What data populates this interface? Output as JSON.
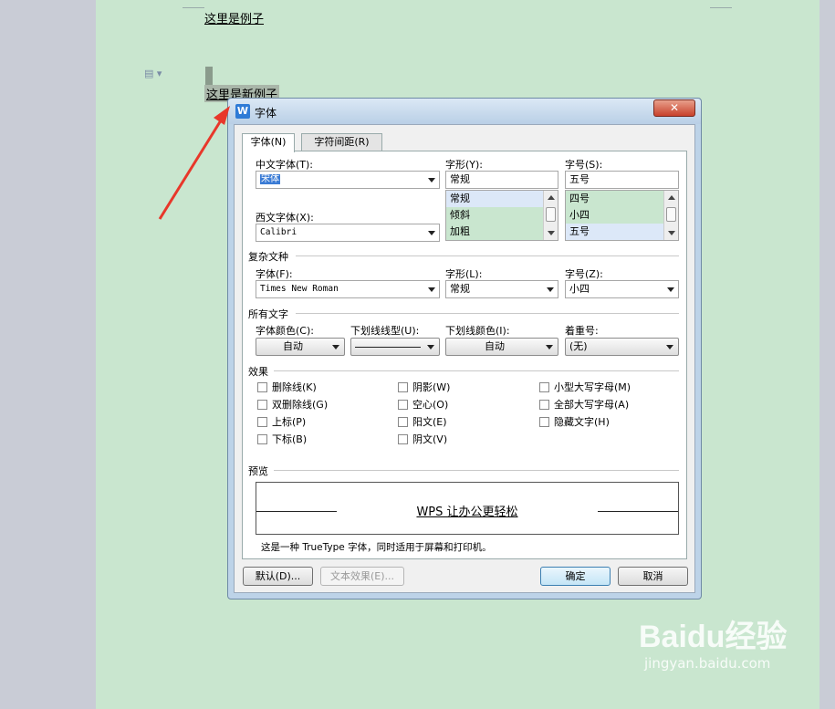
{
  "document": {
    "line1": "这里是例子",
    "line2": "这里是新例子"
  },
  "dialog": {
    "title": "字体",
    "close_label": "✕",
    "tabs": [
      "字体(N)",
      "字符间距(R)"
    ],
    "chinese_font": {
      "label": "中文字体(T):",
      "value": "宋体"
    },
    "western_font": {
      "label": "西文字体(X):",
      "value": "Calibri"
    },
    "style": {
      "label": "字形(Y):",
      "value": "常规",
      "options": [
        "常规",
        "倾斜",
        "加粗"
      ],
      "selected_index": 0
    },
    "size": {
      "label": "字号(S):",
      "value": "五号",
      "options": [
        "四号",
        "小四",
        "五号"
      ],
      "selected_index": 2
    },
    "complex_script": {
      "title": "复杂文种",
      "font_label": "字体(F):",
      "font_value": "Times New Roman",
      "style_label": "字形(L):",
      "style_value": "常规",
      "size_label": "字号(Z):",
      "size_value": "小四"
    },
    "all_text": {
      "title": "所有文字",
      "color_label": "字体颜色(C):",
      "color_value": "自动",
      "underline_label": "下划线线型(U):",
      "underline_color_label": "下划线颜色(I):",
      "underline_color_value": "自动",
      "emphasis_label": "着重号:",
      "emphasis_value": "(无)"
    },
    "effects": {
      "title": "效果",
      "items": [
        "删除线(K)",
        "双删除线(G)",
        "上标(P)",
        "下标(B)",
        "阴影(W)",
        "空心(O)",
        "阳文(E)",
        "阴文(V)",
        "小型大写字母(M)",
        "全部大写字母(A)",
        "隐藏文字(H)"
      ]
    },
    "preview": {
      "title": "预览",
      "sample": "WPS 让办公更轻松",
      "note": "这是一种 TrueType 字体，同时适用于屏幕和打印机。"
    },
    "buttons": {
      "default": "默认(D)...",
      "text_effects": "文本效果(E)...",
      "ok": "确定",
      "cancel": "取消"
    }
  },
  "watermark": {
    "logo": "Baidu经验",
    "url": "jingyan.baidu.com"
  }
}
